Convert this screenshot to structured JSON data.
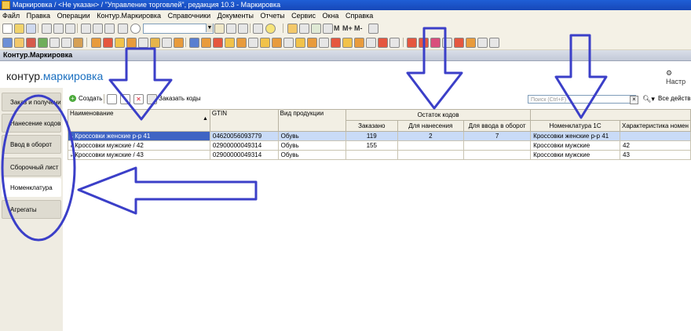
{
  "window": {
    "title": "Маркировка / <Не указан> / \"Управление торговлей\", редакция 10.3 - Маркировка"
  },
  "menu": [
    "Файл",
    "Правка",
    "Операции",
    "Контур.Маркировка",
    "Справочники",
    "Документы",
    "Отчеты",
    "Сервис",
    "Окна",
    "Справка"
  ],
  "toolbar": {
    "m1": "M",
    "m2": "M+",
    "m3": "M-"
  },
  "form": {
    "title": "Контур.Маркировка",
    "logo_a": "контур",
    "logo_b": ".маркировка",
    "settings": "Настр"
  },
  "sidebar": {
    "items": [
      "Заказ и получение",
      "Нанесение кодов",
      "Ввод в оборот",
      "Сборочный лист",
      "Номенклатура",
      "Агрегаты"
    ],
    "active": "Номенклатура"
  },
  "grid_toolbar": {
    "create": "Создать",
    "order": "Заказать коды",
    "search_placeholder": "Поиск (Ctrl+F)",
    "all_actions": "Все действ"
  },
  "table": {
    "headers": {
      "name": "Наименование",
      "gtin": "GTIN",
      "type": "Вид продукции",
      "group": "Остаток кодов",
      "ordered": "Заказано",
      "to_apply": "Для нанесения",
      "to_circ": "Для ввода в оборот",
      "nom1c": "Номенклатура 1С",
      "char": "Характеристика номен"
    },
    "rows": [
      {
        "name": "Кроссовки женские р-р 41",
        "gtin": "04620056093779",
        "type": "Обувь",
        "ordered": "119",
        "to_apply": "2",
        "to_circ": "7",
        "nom1c": "Кроссовки женские р-р 41",
        "char": ""
      },
      {
        "name": "Кроссовки мужские / 42",
        "gtin": "02900000049314",
        "type": "Обувь",
        "ordered": "155",
        "to_apply": "",
        "to_circ": "",
        "nom1c": "Кроссовки мужские",
        "char": "42"
      },
      {
        "name": "Кроссовки мужские / 43",
        "gtin": "02900000049314",
        "type": "Обувь",
        "ordered": "",
        "to_apply": "",
        "to_circ": "",
        "nom1c": "Кроссовки мужские",
        "char": "43"
      }
    ]
  },
  "colors": {
    "annotation": "#3b3fc8",
    "titlebar": "#1f5fd6",
    "selection": "#3f64c4"
  }
}
